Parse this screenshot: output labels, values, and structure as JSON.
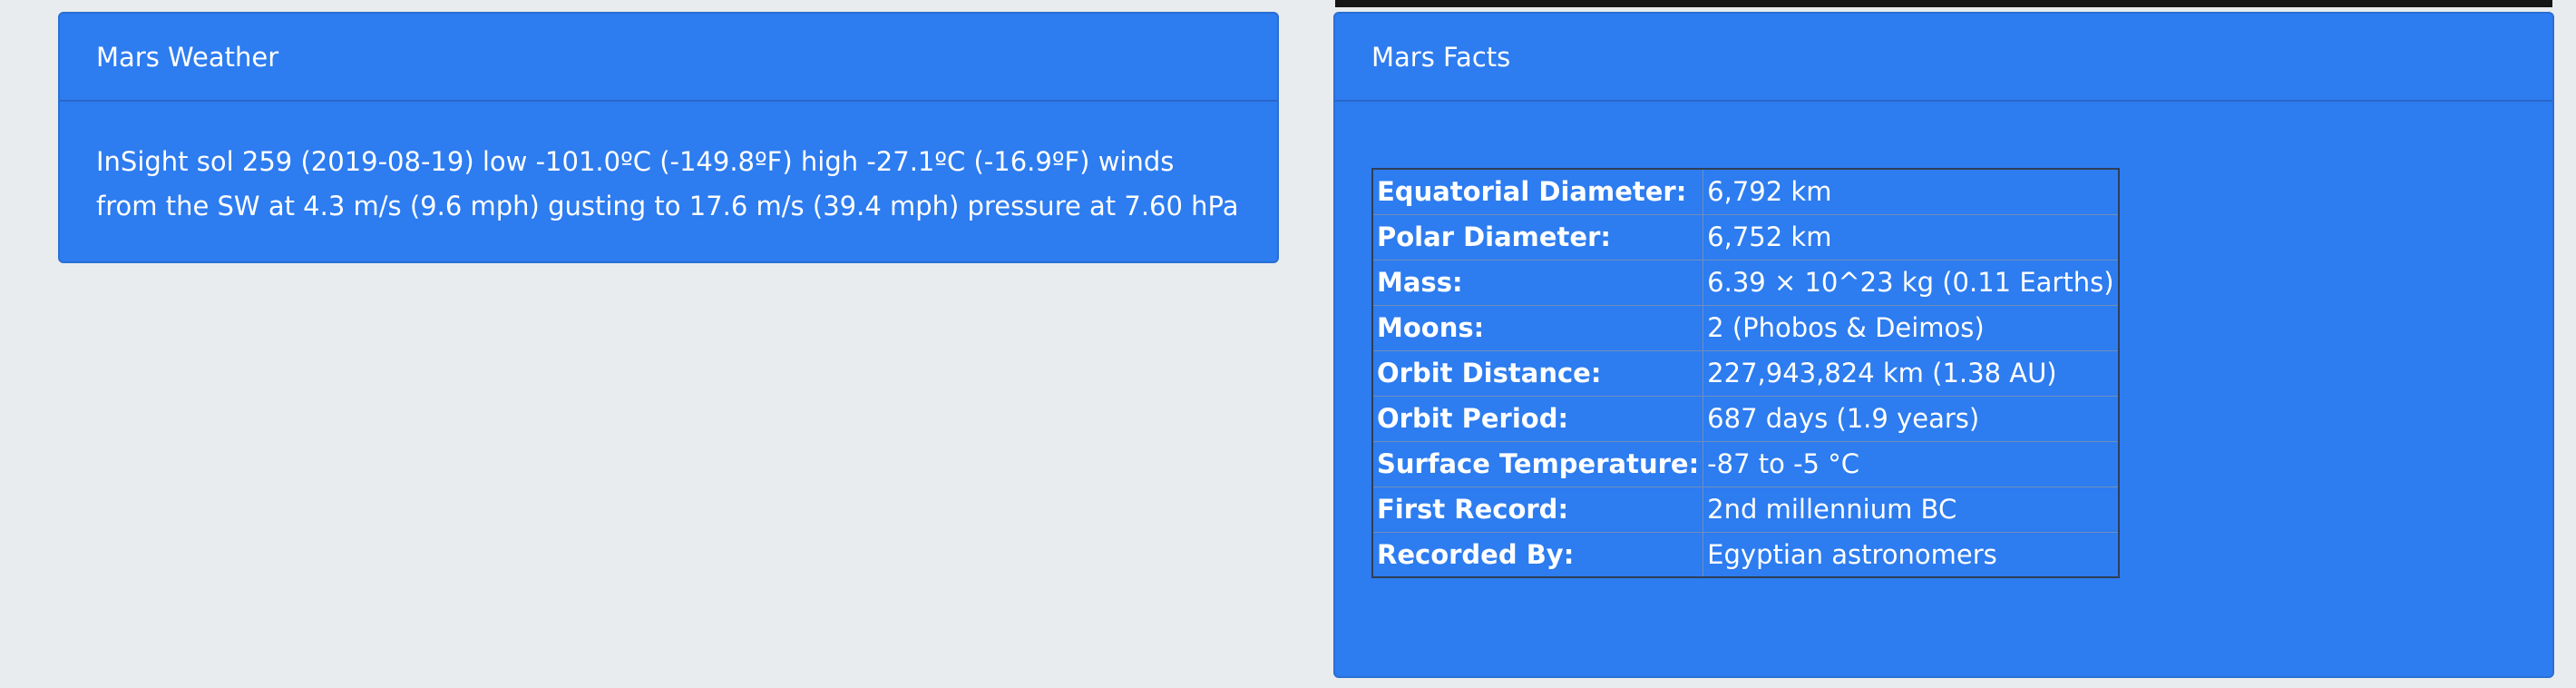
{
  "weather": {
    "title": "Mars Weather",
    "text": "InSight sol 259 (2019-08-19) low -101.0ºC (-149.8ºF) high -27.1ºC (-16.9ºF) winds from the SW at 4.3 m/s (9.6 mph) gusting to 17.6 m/s (39.4 mph) pressure at 7.60 hPa"
  },
  "facts": {
    "title": "Mars Facts",
    "rows": [
      {
        "label": "Equatorial Diameter:",
        "value": "6,792 km"
      },
      {
        "label": "Polar Diameter:",
        "value": "6,752 km"
      },
      {
        "label": "Mass:",
        "value": "6.39 × 10^23 kg (0.11 Earths)"
      },
      {
        "label": "Moons:",
        "value": "2 (Phobos & Deimos)"
      },
      {
        "label": "Orbit Distance:",
        "value": "227,943,824 km (1.38 AU)"
      },
      {
        "label": "Orbit Period:",
        "value": "687 days (1.9 years)"
      },
      {
        "label": "Surface Temperature:",
        "value": "-87 to -5 °C"
      },
      {
        "label": "First Record:",
        "value": "2nd millennium BC"
      },
      {
        "label": "Recorded By:",
        "value": "Egyptian astronomers"
      }
    ]
  },
  "colors": {
    "page_background": "#e9ecef",
    "card_background": "#2d7cf0",
    "text": "#ffffff"
  }
}
